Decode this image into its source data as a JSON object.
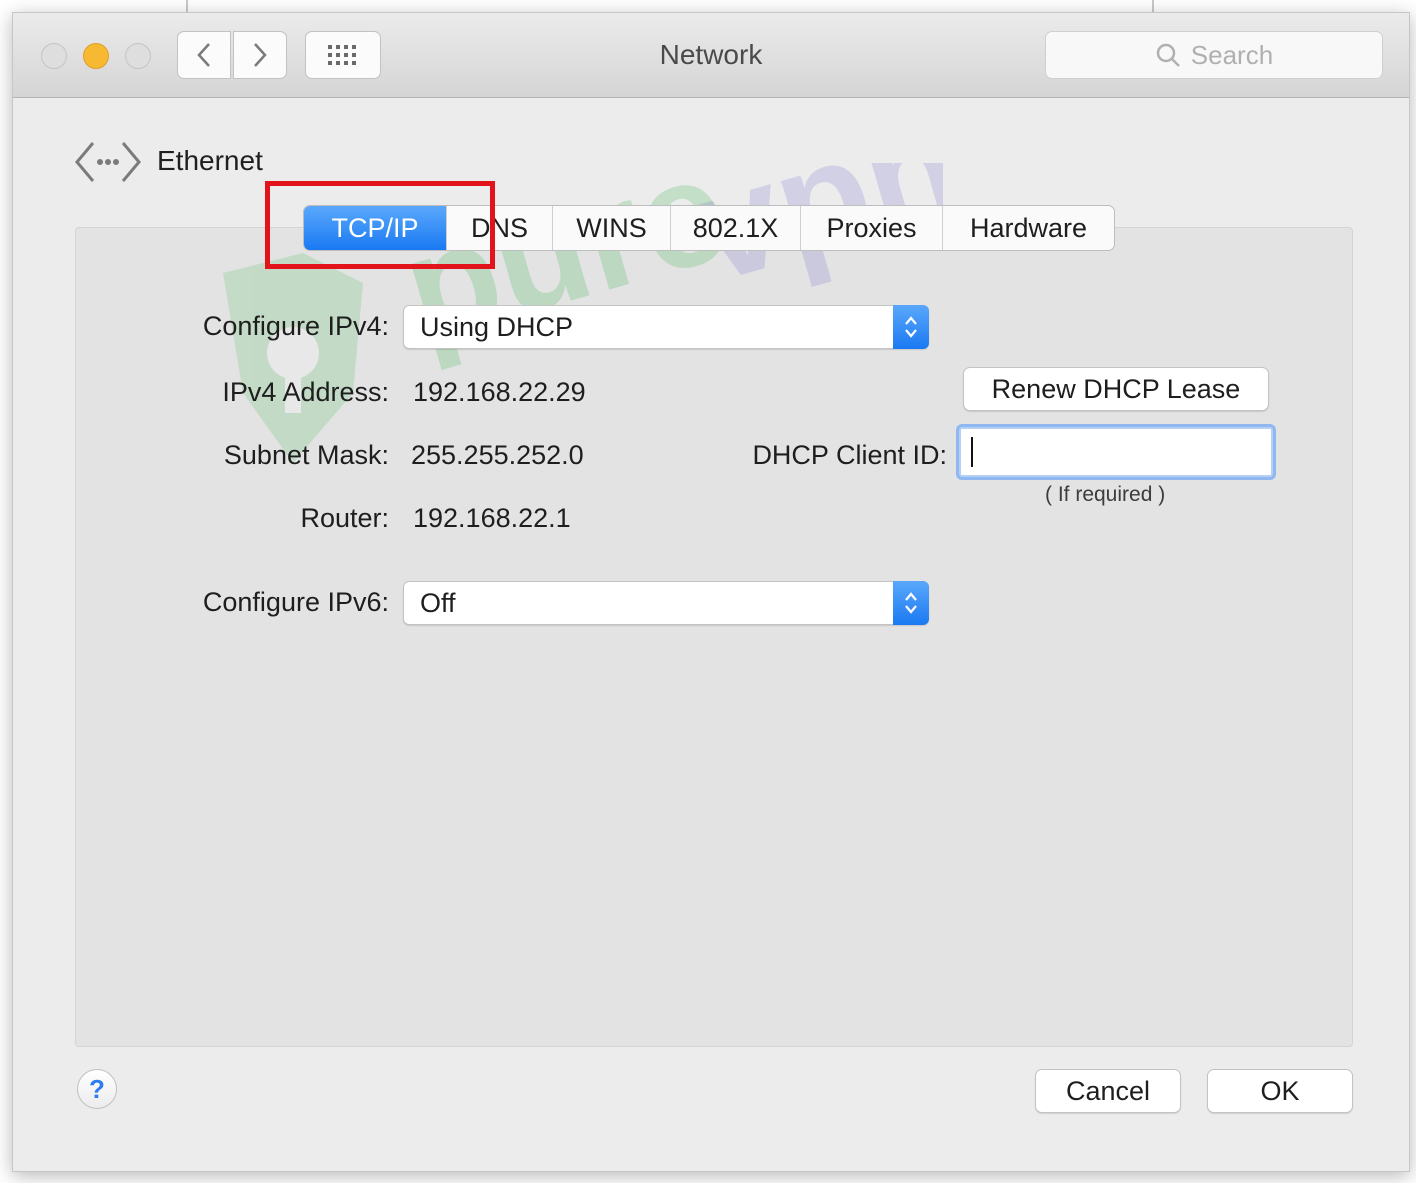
{
  "window": {
    "title": "Network"
  },
  "toolbar": {
    "back_icon": "chevron-left-icon",
    "forward_icon": "chevron-right-icon",
    "grid_icon": "grid-icon",
    "search_placeholder": "Search"
  },
  "header": {
    "interface_name": "Ethernet",
    "icon": "ethernet-icon"
  },
  "tabs": [
    {
      "label": "TCP/IP",
      "active": true
    },
    {
      "label": "DNS",
      "active": false
    },
    {
      "label": "WINS",
      "active": false
    },
    {
      "label": "802.1X",
      "active": false
    },
    {
      "label": "Proxies",
      "active": false
    },
    {
      "label": "Hardware",
      "active": false
    }
  ],
  "form": {
    "configure_ipv4_label": "Configure IPv4:",
    "configure_ipv4_value": "Using DHCP",
    "ipv4_address_label": "IPv4 Address:",
    "ipv4_address_value": "192.168.22.29",
    "subnet_mask_label": "Subnet Mask:",
    "subnet_mask_value": "255.255.252.0",
    "router_label": "Router:",
    "router_value": "192.168.22.1",
    "configure_ipv6_label": "Configure IPv6:",
    "configure_ipv6_value": "Off",
    "renew_button": "Renew DHCP Lease",
    "client_id_label": "DHCP Client ID:",
    "client_id_value": "",
    "client_id_hint": "( If required )"
  },
  "footer": {
    "help_label": "?",
    "cancel_label": "Cancel",
    "ok_label": "OK"
  },
  "watermark": {
    "text": "purevpn"
  },
  "colors": {
    "accent": "#1a79f2",
    "highlight": "#e3131b",
    "traffic_yellow": "#f7b932"
  }
}
